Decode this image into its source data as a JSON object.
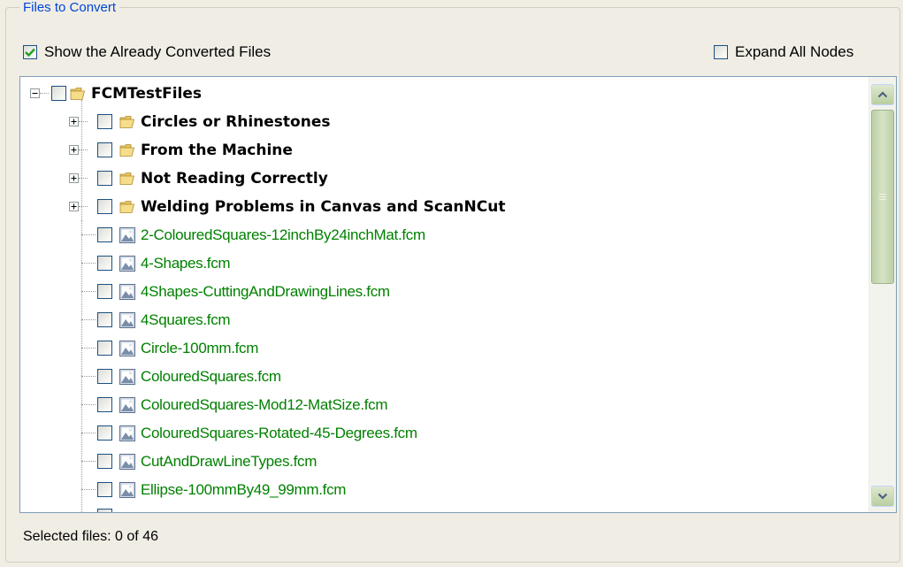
{
  "group": {
    "legend": "Files to Convert"
  },
  "options": {
    "show_converted_label": "Show the Already Converted Files",
    "show_converted_checked": true,
    "expand_all_label": "Expand All Nodes",
    "expand_all_checked": false
  },
  "tree": {
    "root": {
      "label": "FCMTestFiles",
      "icon": "folder-icon",
      "expanded": true,
      "checked": false
    },
    "folders": [
      {
        "label": "Circles or Rhinestones",
        "icon": "folder-icon"
      },
      {
        "label": "From the Machine",
        "icon": "folder-icon"
      },
      {
        "label": "Not Reading Correctly",
        "icon": "folder-icon"
      },
      {
        "label": "Welding Problems in Canvas and ScanNCut",
        "icon": "folder-icon"
      }
    ],
    "files": [
      {
        "label": "2-ColouredSquares-12inchBy24inchMat.fcm",
        "icon": "image-file-icon"
      },
      {
        "label": "4-Shapes.fcm",
        "icon": "image-file-icon"
      },
      {
        "label": "4Shapes-CuttingAndDrawingLines.fcm",
        "icon": "image-file-icon"
      },
      {
        "label": "4Squares.fcm",
        "icon": "image-file-icon"
      },
      {
        "label": "Circle-100mm.fcm",
        "icon": "image-file-icon"
      },
      {
        "label": "ColouredSquares.fcm",
        "icon": "image-file-icon"
      },
      {
        "label": "ColouredSquares-Mod12-MatSize.fcm",
        "icon": "image-file-icon"
      },
      {
        "label": "ColouredSquares-Rotated-45-Degrees.fcm",
        "icon": "image-file-icon"
      },
      {
        "label": "CutAndDrawLineTypes.fcm",
        "icon": "image-file-icon"
      },
      {
        "label": "Ellipse-100mmBy49_99mm.fcm",
        "icon": "image-file-icon"
      }
    ]
  },
  "status": {
    "text": "Selected files: 0 of 46"
  },
  "colors": {
    "legend": "#0046d5",
    "file_text": "#008000",
    "checkmark": "#21a121",
    "scroll_accent": "#b8cfa0"
  }
}
